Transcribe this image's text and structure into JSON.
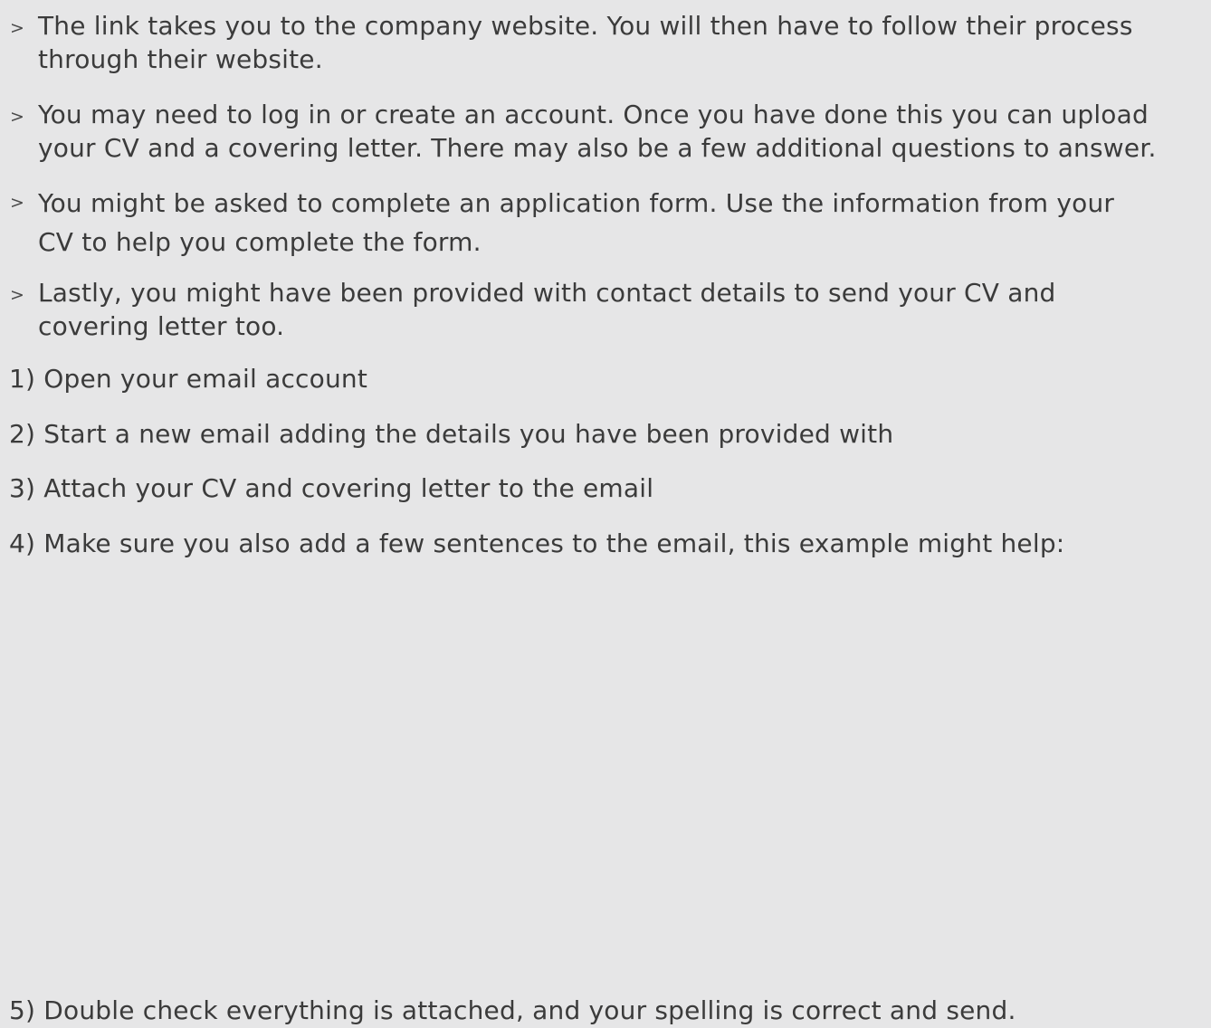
{
  "bullets": [
    {
      "marker": ">",
      "text": "The link takes you to the company website. You will then have to follow their process\nthrough their website."
    },
    {
      "marker": ">",
      "text": "You may need to log in or create an account. Once you have done this you can upload\nyour CV and a covering letter. There may also be a few additional questions to answer."
    },
    {
      "marker": ">",
      "text": "You might be asked to complete an application form. Use the information from your\nCV to help you complete the form."
    },
    {
      "marker": ">",
      "text": "Lastly, you might have been provided with contact details to send your CV and\ncovering letter too."
    }
  ],
  "steps": [
    "1)  Open your email account",
    "2) Start a new email adding the details you have been provided with",
    "3) Attach your CV and covering letter to the email",
    "4) Make sure you also add a few sentences to the email, this example might help:",
    "5) Double check everything is attached, and your spelling is correct and send."
  ]
}
